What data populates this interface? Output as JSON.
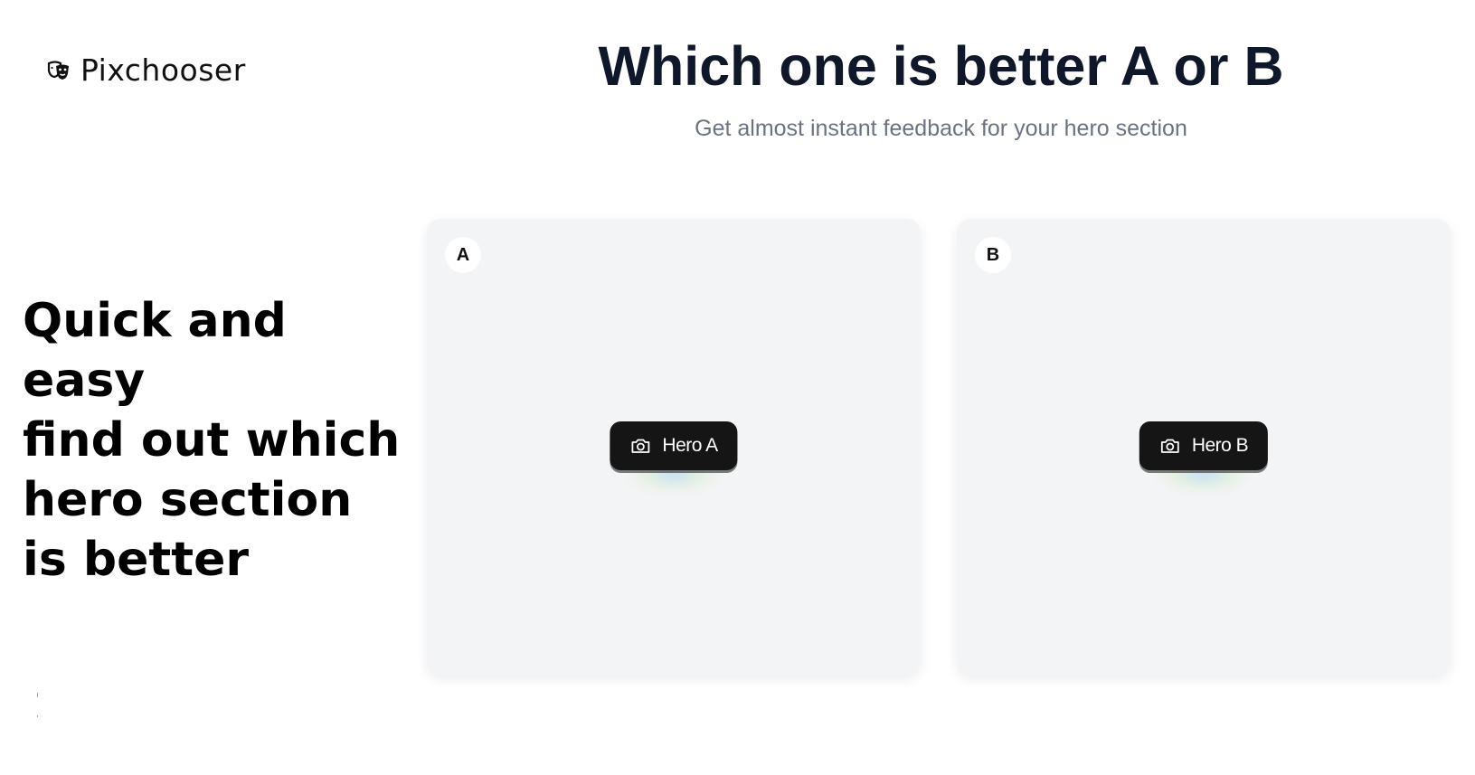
{
  "brand": {
    "name": "Pixchooser",
    "icon": "theater-masks-icon"
  },
  "tagline": "Quick and easy\nfind out which\nhero section\nis better",
  "header": {
    "title": "Which one is better A or B",
    "subtitle": "Get almost instant feedback for your hero section"
  },
  "cards": [
    {
      "badge": "A",
      "button_label": "Hero A",
      "button_icon": "camera-icon"
    },
    {
      "badge": "B",
      "button_label": "Hero B",
      "button_icon": "camera-icon"
    }
  ],
  "colors": {
    "card_background": "#f3f4f6",
    "button_background": "#151515",
    "title": "#0f172a",
    "subtitle": "#6b7280"
  }
}
